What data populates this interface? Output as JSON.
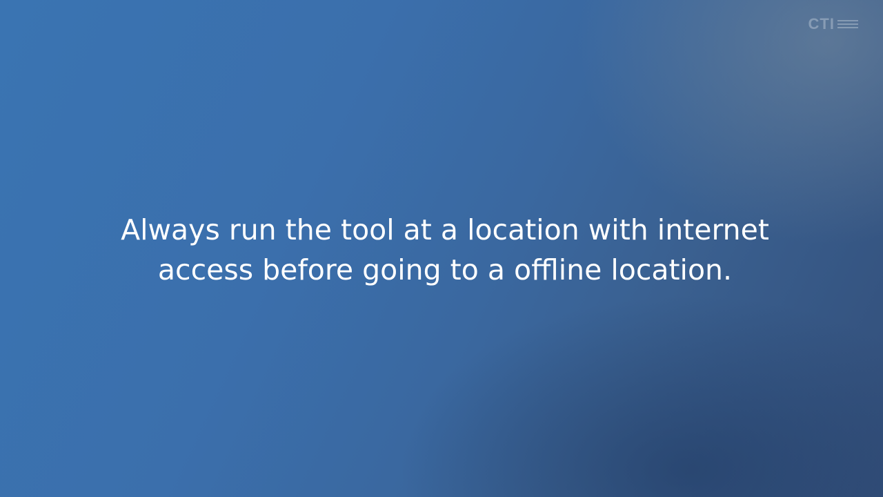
{
  "slide": {
    "logo": {
      "text": "CTI"
    },
    "message": "Always run the tool at a location with internet\naccess before going to a offline location.",
    "colors": {
      "background_start": "#3a74b2",
      "background_end": "#334f7a",
      "text": "#ffffff"
    }
  }
}
